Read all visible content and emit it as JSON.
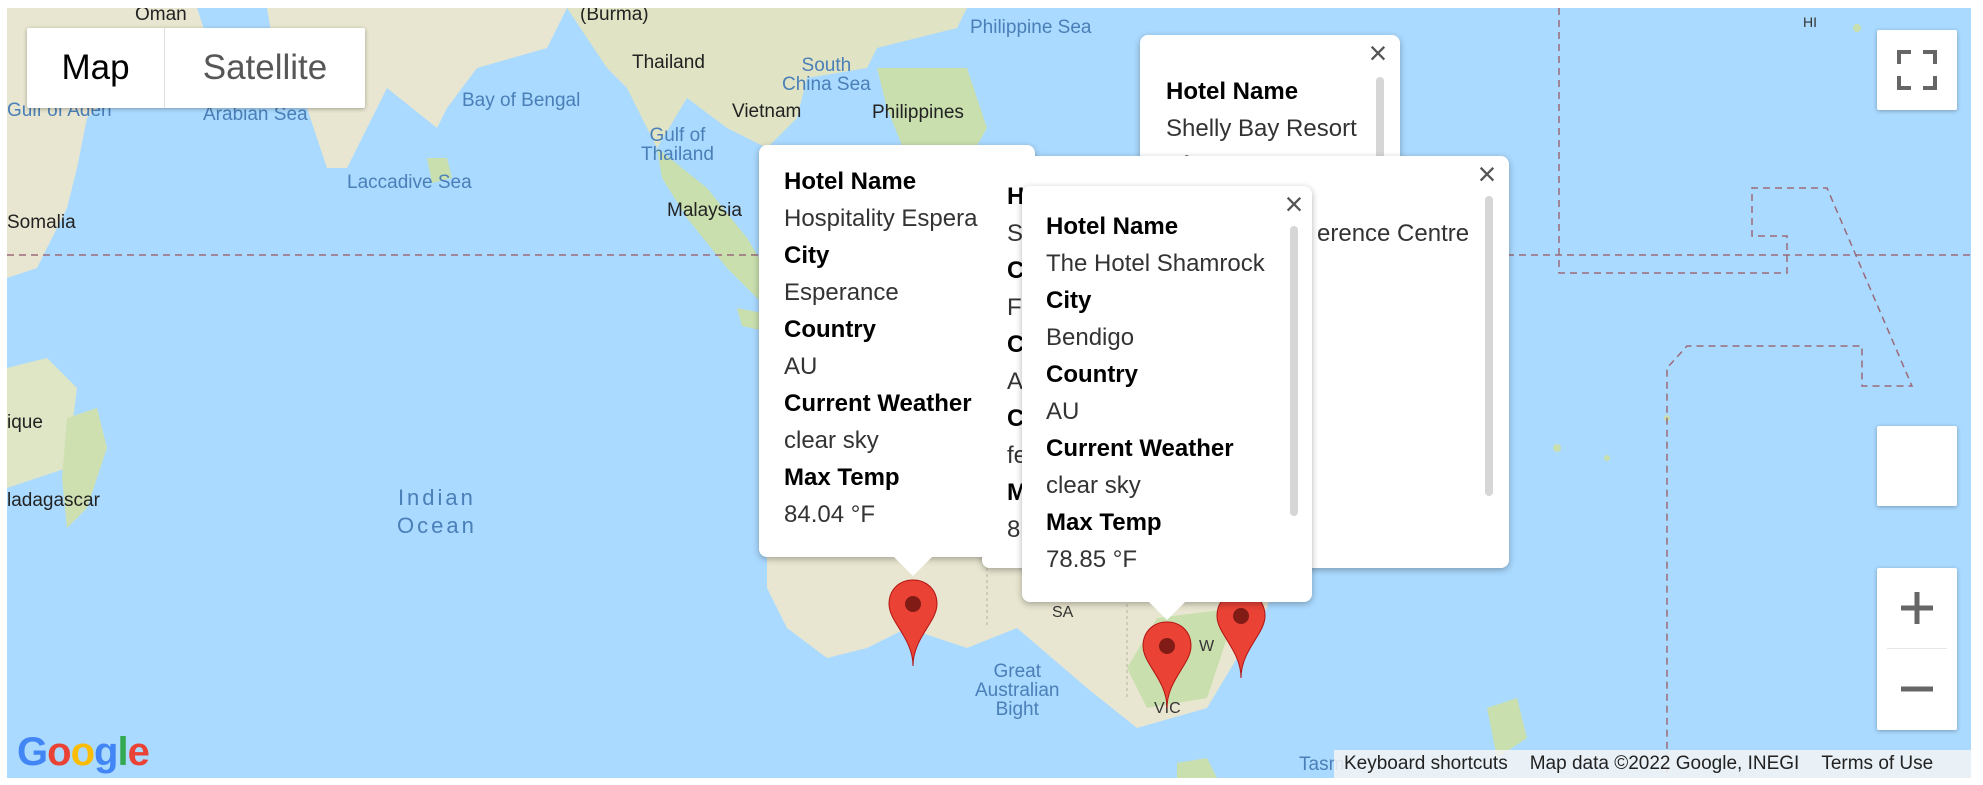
{
  "map_type": {
    "map_label": "Map",
    "satellite_label": "Satellite",
    "selected": "Map"
  },
  "labels": {
    "oman": "Oman",
    "burma": "(Burma)",
    "thailand": "Thailand",
    "philippine_sea": "Philippine Sea",
    "south_china_sea": "South\nChina Sea",
    "gulf_of_aden": "Gulf of Aden",
    "arabian_sea": "Arabian Sea",
    "bay_of_bengal": "Bay of Bengal",
    "vietnam": "Vietnam",
    "philippines": "Philippines",
    "gulf_of_thailand": "Gulf of\nThailand",
    "laccadive_sea": "Laccadive Sea",
    "malaysia": "Malaysia",
    "somalia": "Somalia",
    "mozambique": "ique",
    "madagascar": "ladagascar",
    "indian_ocean": "Indian\nOcean",
    "great_australian_bight": "Great\nAustralian\nBight",
    "sa": "SA",
    "vic": "VIC",
    "nsw": "W",
    "tas": "Tasm",
    "hi": "HI"
  },
  "popups": [
    {
      "id": "shelly-bay",
      "hotel_name_label": "Hotel Name",
      "hotel_name": "Shelly Bay Resort",
      "city_label": "City"
    },
    {
      "id": "conference-centre",
      "hotel_name_partial": "erence Centre",
      "h_partial": "H",
      "s_partial": "Sh",
      "c_partial": "C",
      "fl_partial": "Fl",
      "co_partial": "Co",
      "au_partial": "AU",
      "cu_partial": "Cu",
      "fe_partial": "fe",
      "m_partial": "M",
      "t_partial": "81"
    },
    {
      "id": "esperance",
      "hotel_name_label": "Hotel Name",
      "hotel_name": "Hospitality Espera",
      "city_label": "City",
      "city": "Esperance",
      "country_label": "Country",
      "country": "AU",
      "weather_label": "Current Weather",
      "weather": "clear sky",
      "temp_label": "Max Temp",
      "temp": "84.04 °F"
    },
    {
      "id": "shamrock",
      "hotel_name_label": "Hotel Name",
      "hotel_name": "The Hotel Shamrock",
      "city_label": "City",
      "city": "Bendigo",
      "country_label": "Country",
      "country": "AU",
      "weather_label": "Current Weather",
      "weather": "clear sky",
      "temp_label": "Max Temp",
      "temp": "78.85 °F"
    }
  ],
  "footer": {
    "keyboard": "Keyboard shortcuts",
    "mapdata": "Map data ©2022 Google, INEGI",
    "terms": "Terms of Use"
  },
  "logo": "Google",
  "colors": {
    "water": "#aadaff",
    "land": "#e8e6d0",
    "green": "#c9dfae",
    "marker": "#ea4335"
  }
}
